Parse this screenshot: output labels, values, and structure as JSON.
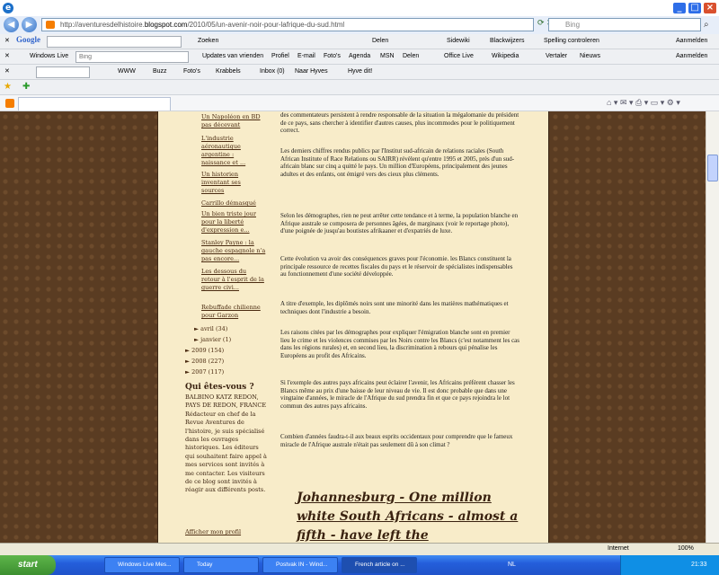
{
  "window": {
    "url_prefix": "http://aventuresdelhistoire.",
    "url_domain": "blogspot.com",
    "url_path": "/2010/05/un-avenir-noir-pour-lafrique-du-sud.html",
    "search_placeholder": "Bing"
  },
  "google_bar": {
    "logo": "Google",
    "items": [
      "Zoeken",
      "Delen",
      "Sidewiki",
      "Blackwijzers",
      "Spelling controleren",
      "Aanmelden"
    ]
  },
  "wl_bar": {
    "brand": "Windows Live",
    "search_placeholder": "Bing",
    "items": [
      "Updates van vrienden",
      "Profiel",
      "E-mail",
      "Foto's",
      "Agenda",
      "MSN",
      "Delen",
      "Office Live",
      "Wikipedia",
      "Vertaler",
      "Nieuws",
      "Aanmelden"
    ]
  },
  "hyves_bar": {
    "items": [
      "WWW",
      "Buzz",
      "Foto's",
      "Krabbels",
      "Inbox (0)",
      "Naar Hyves",
      "Hyve dit!"
    ]
  },
  "sidebar": {
    "links": [
      "Un Napoléon en BD pas décevant",
      "L'industrie aéronautique argentine : naissance et ...",
      "Un historien inventant ses sources",
      "Carrillo démasqué",
      "Un bien triste jour pour la liberté d'expression e...",
      "Stanley Payne : la gauche espagnole n'a pas encore...",
      "Les dessous du retour à l'esprit de la guerre civi...",
      "Rebuffade chilienne pour Garzon"
    ],
    "archive": [
      {
        "label": "avril (34)"
      },
      {
        "label": "janvier (1)"
      },
      {
        "label": "2009 (154)"
      },
      {
        "label": "2008 (227)"
      },
      {
        "label": "2007 (117)"
      }
    ],
    "about_title": "Qui êtes-vous ?",
    "about_text": "BALBINO KATZ REDON, PAYS DE REDON, FRANCE Rédacteur en chef de la Revue Aventures de l'histoire, je suis spécialisé dans les ouvrages historiques. Les éditeurs qui souhaitent faire appel à mes services sont invités à me contacter. Les visiteurs de ce blog sont invités à réagir aux différents posts.",
    "profile_link": "Afficher mon profil"
  },
  "post": {
    "p0": "des commentateurs persistent à rendre responsable de la situation la mégalomanie du président de ce pays, sans chercher à identifier d'autres causes, plus incommodes pour le politiquement correct.",
    "p1": "Les derniers chiffres rendus publics par l'Institut sud-africain de relations raciales (South African Institute of Race Relations ou SAIRR) révèlent qu'entre 1995 et 2005, près d'un sud-africain blanc sur cinq a quitté le pays. Un million d'Européens, principalement des jeunes adultes et des enfants, ont émigré vers des cieux plus cléments.",
    "p2": "Selon les démographes, rien ne peut arrêter cette tendance et à terme, la population blanche en Afrique australe se composera de personnes âgées, de marginaux (voir le reportage photo), d'une poignée de jusqu'au boutistes afrikaaner et d'expatriés de luxe.",
    "p3": "Cette évolution va avoir des conséquences graves pour l'économie. les Blancs constituent la principale ressource de recettes fiscales du pays et le réservoir de spécialistes indispensables au fonctionnement d'une société développée.",
    "p4": "A titre d'exemple, les diplômés noirs sont une minorité dans les matières mathématiques et techniques dont l'industrie a besoin.",
    "p5": "Les raisons citées par les démographes pour expliquer l'émigration blanche sont en premier lieu le crime et les violences commises par les Noirs contre les Blancs (c'est notamment les cas dans les régions rurales) et, en second lieu, la discrimination à rebours qui pénalise les Européens au profit des Africains.",
    "p6": "Si l'exemple des autres pays africains peut éclairer l'avenir, les Africains préfèrent chasser les Blancs même au prix d'une baisse de leur niveau de vie. Il est donc probable que dans une vingtaine d'années, le miracle de l'Afrique du sud prendra fin et que ce pays rejoindra le lot commun des autres pays africains.",
    "p7": "Combien d'années faudra-t-il aux beaux esprits occidentaux pour comprendre que le fameux miracle de l'Afrique australe n'était pas seulement dû à son climat ?",
    "headline": "Johannesburg - One million white South Africans - almost a fifth - have left the"
  },
  "status": {
    "zone": "Internet",
    "zoom": "100%"
  },
  "taskbar": {
    "start": "start",
    "tasks": [
      "Windows Live Mes...",
      "Today",
      "Postvak IN - Wind...",
      "French article on ..."
    ],
    "lang": "NL",
    "clock": "21:33"
  }
}
